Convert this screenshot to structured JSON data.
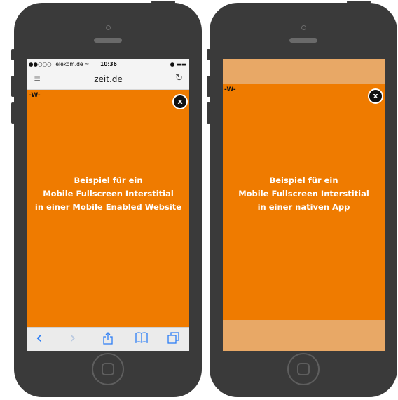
{
  "left_phone": {
    "statusbar": {
      "carrier": "●●○○○ Telekom.de ≈",
      "time": "10:36",
      "right": "● ▬▬"
    },
    "urlbar": {
      "menu_icon": "≡",
      "url": "zeit.de",
      "reload_icon": "↻"
    },
    "ad": {
      "logo": "-W-",
      "close_label": "x",
      "line1": "Beispiel für ein",
      "line2": "Mobile Fullscreen Interstitial",
      "line3": "in einer Mobile Enabled Website"
    },
    "toolbar": {
      "back_icon": "‹",
      "forward_icon": "›"
    }
  },
  "right_phone": {
    "ad": {
      "logo": "-W-",
      "close_label": "x",
      "line1": "Beispiel für ein",
      "line2": "Mobile Fullscreen Interstitial",
      "line3": "in einer nativen App"
    }
  },
  "colors": {
    "phone_body": "#3a3a3a",
    "ad_orange": "#ef7b00",
    "app_bar": "#e8a866",
    "ios_blue": "#2c7ef5"
  }
}
